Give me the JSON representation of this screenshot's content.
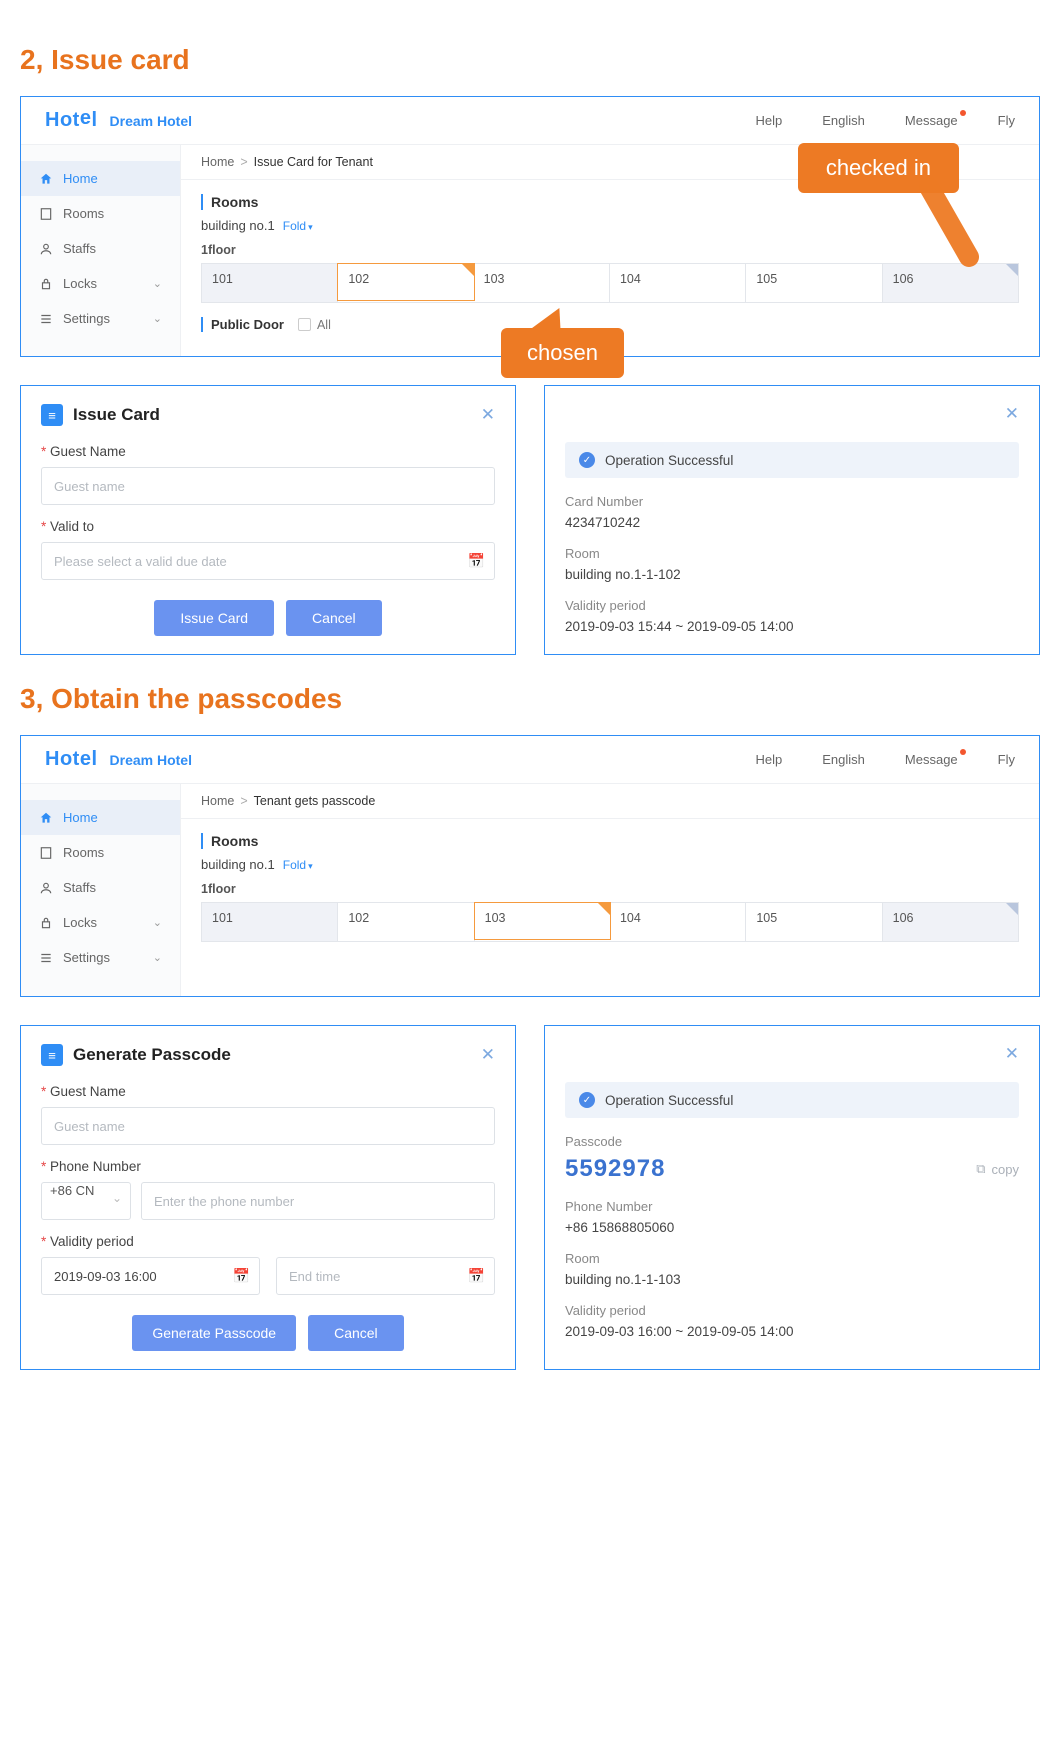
{
  "section2": "2, Issue card",
  "section3": "3, Obtain the passcodes",
  "colors": {
    "primary": "#2f8df5",
    "accent": "#ed7a24"
  },
  "app": {
    "logo": "Hotel",
    "brand": "Dream Hotel",
    "nav": {
      "help": "Help",
      "lang": "English",
      "msg": "Message",
      "user": "Fly"
    },
    "sidebar": {
      "home": "Home",
      "rooms": "Rooms",
      "staffs": "Staffs",
      "locks": "Locks",
      "settings": "Settings"
    }
  },
  "panel1": {
    "crumb1": "Home",
    "crumb2": "Issue Card for Tenant",
    "roomsHead": "Rooms",
    "building": "building no.1",
    "fold": "Fold",
    "floor": "1floor",
    "rooms": [
      "101",
      "102",
      "103",
      "104",
      "105",
      "106"
    ],
    "publicDoor": "Public Door",
    "all": "All",
    "callout1": "checked in",
    "callout2": "chosen"
  },
  "modal1": {
    "title": "Issue Card",
    "guestLbl": "Guest Name",
    "guestPh": "Guest name",
    "validLbl": "Valid to",
    "validPh": "Please select a valid due date",
    "ok": "Issue Card",
    "cancel": "Cancel"
  },
  "result1": {
    "succ": "Operation Successful",
    "cardLbl": "Card Number",
    "cardVal": "4234710242",
    "roomLbl": "Room",
    "roomVal": "building no.1-1-102",
    "periodLbl": "Validity period",
    "periodVal": "2019-09-03 15:44  ~  2019-09-05 14:00"
  },
  "panel2": {
    "crumb1": "Home",
    "crumb2": "Tenant gets passcode",
    "roomsHead": "Rooms",
    "building": "building no.1",
    "fold": "Fold",
    "floor": "1floor",
    "rooms": [
      "101",
      "102",
      "103",
      "104",
      "105",
      "106"
    ]
  },
  "modal2": {
    "title": "Generate Passcode",
    "guestLbl": "Guest Name",
    "guestPh": "Guest name",
    "phoneLbl": "Phone Number",
    "cc": "+86 CN",
    "phonePh": "Enter the phone number",
    "periodLbl": "Validity period",
    "start": "2019-09-03 16:00",
    "endPh": "End time",
    "ok": "Generate Passcode",
    "cancel": "Cancel"
  },
  "result2": {
    "succ": "Operation Successful",
    "codeLbl": "Passcode",
    "codeVal": "5592978",
    "copy": "copy",
    "phoneLbl": "Phone Number",
    "phoneVal": "+86 15868805060",
    "roomLbl": "Room",
    "roomVal": "building no.1-1-103",
    "periodLbl": "Validity period",
    "periodVal": "2019-09-03 16:00  ~  2019-09-05 14:00"
  }
}
